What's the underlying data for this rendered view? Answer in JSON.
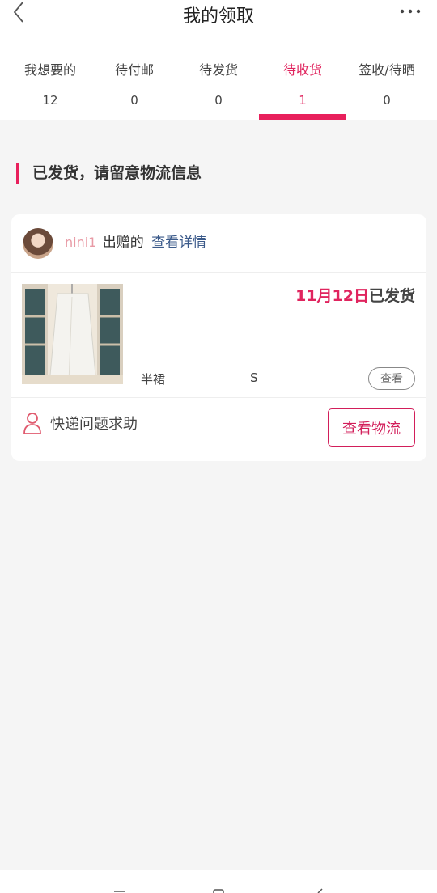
{
  "header": {
    "title": "我的领取"
  },
  "tabs": [
    {
      "label": "我想要的",
      "count": "12"
    },
    {
      "label": "待付邮",
      "count": "0"
    },
    {
      "label": "待发货",
      "count": "0"
    },
    {
      "label": "待收货",
      "count": "1"
    },
    {
      "label": "签收/待晒",
      "count": "0"
    }
  ],
  "section": {
    "title": "已发货，请留意物流信息"
  },
  "order": {
    "donor_name": "nini1",
    "donor_suffix": "出赠的",
    "detail_link": "查看详情",
    "ship_date": "11月12日",
    "ship_status": "已发货",
    "item_name": "半裙",
    "item_size": "S",
    "view_button": "查看",
    "help_label": "快递问题求助",
    "logistics_button": "查看物流"
  },
  "colors": {
    "accent": "#e0245e",
    "link": "#3b5a8a",
    "background": "#f5f5f5"
  },
  "icons": [
    "back-chevron-icon",
    "more-dots-icon",
    "user-outline-icon"
  ]
}
